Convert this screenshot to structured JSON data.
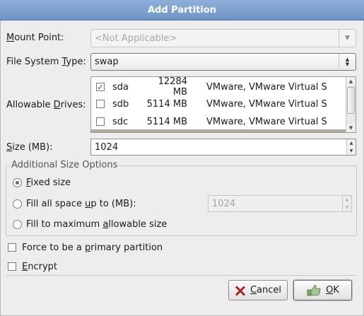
{
  "dialog": {
    "title": "Add Partition"
  },
  "mount_point": {
    "label_pre": "",
    "label_mnemonic": "M",
    "label_post": "ount Point:",
    "value": "<Not Applicable>"
  },
  "fs_type": {
    "label_pre": "File System ",
    "label_mnemonic": "T",
    "label_post": "ype:",
    "value": "swap"
  },
  "drives": {
    "label_pre": "Allowable ",
    "label_mnemonic": "D",
    "label_post": "rives:",
    "rows": [
      {
        "checked": true,
        "name": "sda",
        "size": "12284 MB",
        "model": "VMware, VMware Virtual S"
      },
      {
        "checked": false,
        "name": "sdb",
        "size": "5114 MB",
        "model": "VMware, VMware Virtual S"
      },
      {
        "checked": false,
        "name": "sdc",
        "size": "5114 MB",
        "model": "VMware, VMware Virtual S"
      }
    ]
  },
  "size": {
    "label_pre": "",
    "label_mnemonic": "S",
    "label_post": "ize (MB):",
    "value": "1024"
  },
  "size_options": {
    "legend": "Additional Size Options",
    "fixed": {
      "pre": "",
      "mn": "F",
      "post": "ixed size",
      "selected": true
    },
    "fill_upto": {
      "pre": "Fill all space ",
      "mn": "u",
      "post": "p to (MB):",
      "selected": false,
      "value": "1024"
    },
    "fill_max": {
      "pre": "Fill to maximum ",
      "mn": "a",
      "post": "llowable size",
      "selected": false
    }
  },
  "force_primary": {
    "pre": "Force to be a ",
    "mn": "p",
    "post": "rimary partition",
    "checked": false
  },
  "encrypt": {
    "pre": "",
    "mn": "E",
    "post": "ncrypt",
    "checked": false
  },
  "buttons": {
    "cancel": {
      "pre": "",
      "mn": "C",
      "post": "ancel"
    },
    "ok": {
      "pre": "",
      "mn": "O",
      "post": "K"
    }
  },
  "icons": {
    "cancel": "x-icon",
    "ok": "hand-ok-icon"
  },
  "colors": {
    "title_bar": "#7a9ccf",
    "background": "#ededed"
  }
}
